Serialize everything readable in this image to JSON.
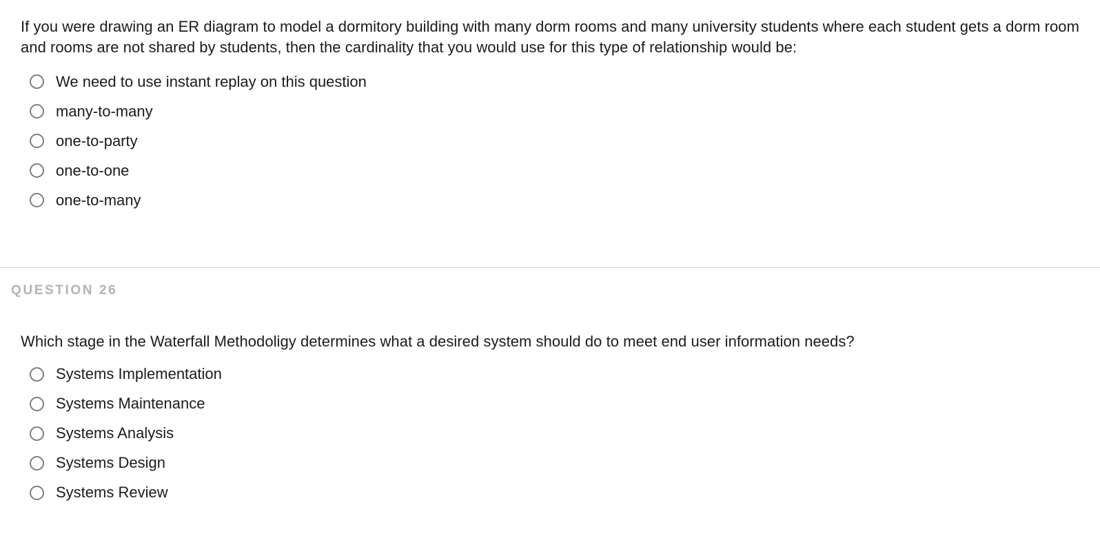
{
  "page": {
    "background_color": "#ffffff",
    "text_color": "#1b1b1b",
    "header_color": "#b3b3b3",
    "divider_color": "#d2d2d2",
    "radio_border_color": "#7d7d7d"
  },
  "questions": [
    {
      "header": "",
      "prompt": "If you were drawing an ER diagram to model a dormitory building with many dorm rooms and many university students where each student gets a dorm room and rooms are not shared by students, then the cardinality that you would use for this type of relationship would be:",
      "options": [
        {
          "label": "We need to use instant replay on this question",
          "selected": false
        },
        {
          "label": "many-to-many",
          "selected": false
        },
        {
          "label": "one-to-party",
          "selected": false
        },
        {
          "label": "one-to-one",
          "selected": false
        },
        {
          "label": "one-to-many",
          "selected": false
        }
      ]
    },
    {
      "header": "QUESTION 26",
      "prompt": "Which stage in the Waterfall Methodoligy determines what a desired system should do to meet end user information needs?",
      "options": [
        {
          "label": "Systems Implementation",
          "selected": false
        },
        {
          "label": "Systems Maintenance",
          "selected": false
        },
        {
          "label": "Systems Analysis",
          "selected": false
        },
        {
          "label": "Systems Design",
          "selected": false
        },
        {
          "label": "Systems Review",
          "selected": false
        }
      ]
    }
  ]
}
